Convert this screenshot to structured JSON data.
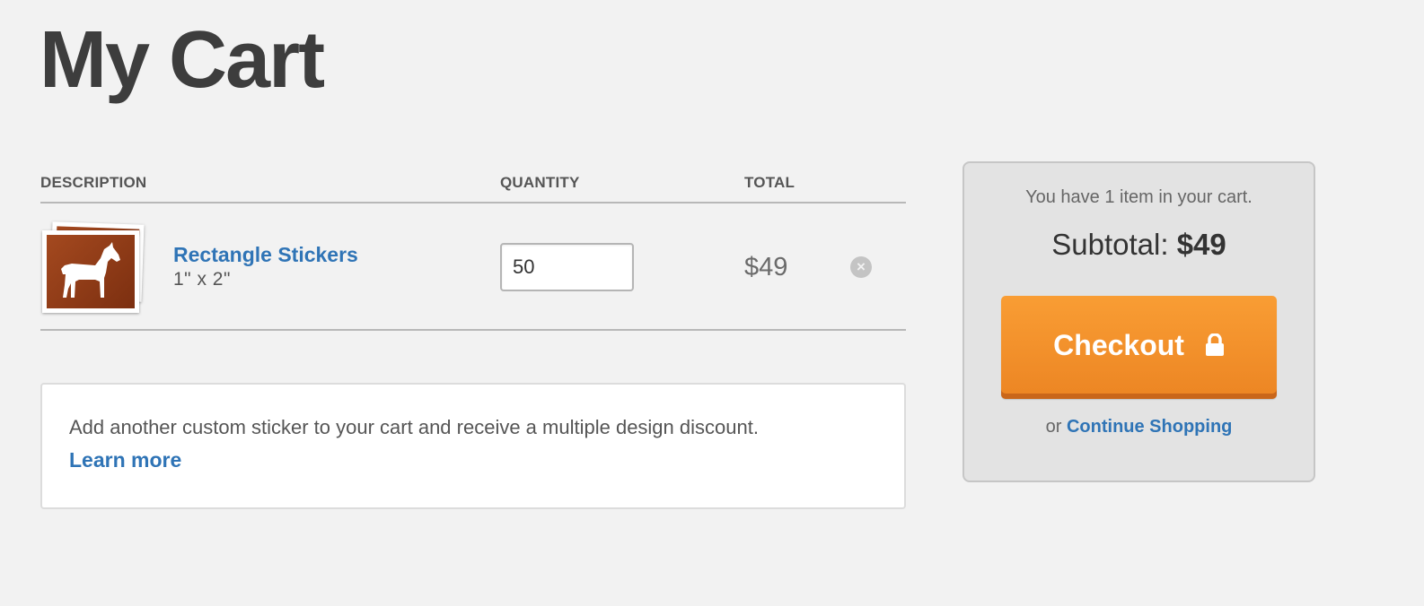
{
  "page": {
    "title": "My Cart"
  },
  "table": {
    "headers": {
      "description": "DESCRIPTION",
      "quantity": "QUANTITY",
      "total": "TOTAL"
    },
    "rows": [
      {
        "name": "Rectangle Stickers",
        "size": "1\" x 2\"",
        "quantity": "50",
        "total": "$49",
        "thumbnail_icon": "horse-icon",
        "remove_icon": "remove-circle-x-icon"
      }
    ]
  },
  "promo": {
    "text": "Add another custom sticker to your cart and receive a multiple design discount.",
    "link": "Learn more"
  },
  "summary": {
    "item_count_text": "You have 1 item in your cart.",
    "subtotal_label": "Subtotal:",
    "subtotal_amount": "$49",
    "checkout_label": "Checkout",
    "checkout_icon": "lock-icon",
    "or_text": "or",
    "continue_label": "Continue Shopping"
  },
  "colors": {
    "background": "#f2f2f2",
    "link": "#2f74b6",
    "checkout_orange": "#f99d34",
    "thumbnail_brown": "#8c3a16"
  }
}
